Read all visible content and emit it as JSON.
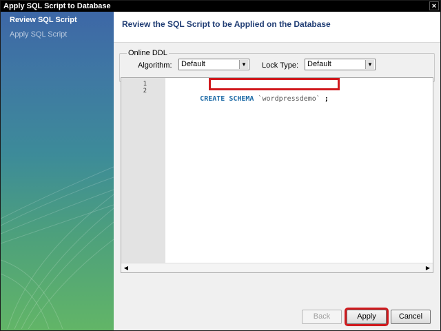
{
  "window": {
    "title": "Apply SQL Script to Database",
    "close_label": "×"
  },
  "sidebar": {
    "items": [
      {
        "label": "Review SQL Script"
      },
      {
        "label": "Apply SQL Script"
      }
    ]
  },
  "header": {
    "title": "Review the SQL Script to be Applied on the Database"
  },
  "online_ddl": {
    "legend": "Online DDL",
    "algorithm_label": "Algorithm:",
    "algorithm_value": "Default",
    "lock_type_label": "Lock Type:",
    "lock_type_value": "Default"
  },
  "editor": {
    "line_numbers": [
      "1",
      "2"
    ],
    "line1": {
      "keyword": "CREATE SCHEMA",
      "identifier": "`wordpressdemo`",
      "terminator": ";"
    }
  },
  "buttons": {
    "back": "Back",
    "apply": "Apply",
    "cancel": "Cancel"
  },
  "colors": {
    "highlight": "#d0191d",
    "title_text": "#1f3c73",
    "keyword": "#1c6aa6"
  }
}
